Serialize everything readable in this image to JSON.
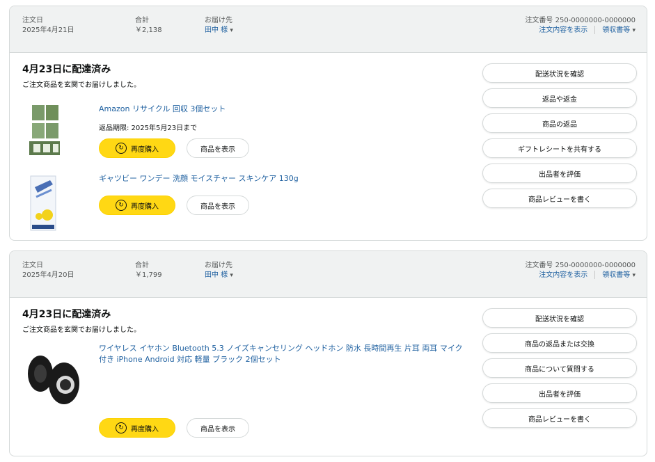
{
  "orders": [
    {
      "header": {
        "date_label": "注文日",
        "date_value": "2025年4月21日",
        "total_label": "合計",
        "total_value": "￥2,138",
        "ship_label": "お届け先",
        "ship_value": "田中 様",
        "order_no": "注文番号 250-0000000-0000000",
        "details_link": "注文内容を表示",
        "receipt_link": "領収書等"
      },
      "status": "4月23日に配達済み",
      "substatus": "ご注文商品を玄関でお届けしました。",
      "items": [
        {
          "title": "Amazon リサイクル 回収 3個セット",
          "meta": "返品期限: 2025年5月23日まで",
          "buy_again": "再度購入",
          "view": "商品を表示"
        },
        {
          "title": "ギャツビー ワンデー 洗顔 モイスチャー スキンケア 130g",
          "meta": "",
          "buy_again": "再度購入",
          "view": "商品を表示"
        }
      ],
      "actions": [
        "配送状況を確認",
        "返品や返金",
        "商品の返品",
        "ギフトレシートを共有する",
        "出品者を評価",
        "商品レビューを書く"
      ]
    },
    {
      "header": {
        "date_label": "注文日",
        "date_value": "2025年4月20日",
        "total_label": "合計",
        "total_value": "￥1,799",
        "ship_label": "お届け先",
        "ship_value": "田中 様",
        "order_no": "注文番号 250-0000000-0000000",
        "details_link": "注文内容を表示",
        "receipt_link": "領収書等"
      },
      "status": "4月23日に配達済み",
      "substatus": "ご注文商品を玄関でお届けしました。",
      "items": [
        {
          "title": "ワイヤレス イヤホン Bluetooth 5.3 ノイズキャンセリング ヘッドホン 防水 長時間再生 片耳 両耳 マイク付き iPhone Android 対応 軽量 ブラック 2個セット",
          "meta": "",
          "buy_again": "再度購入",
          "view": "商品を表示"
        }
      ],
      "actions": [
        "配送状況を確認",
        "商品の返品または交換",
        "商品について質問する",
        "出品者を評価",
        "商品レビューを書く"
      ]
    }
  ],
  "colors": {
    "accent_link": "#2162a1",
    "buy_again": "#ffd814",
    "header_bg": "#f0f2f2"
  },
  "icons": {
    "buy_again": "refresh-icon",
    "dropdown": "chevron-down-icon"
  }
}
